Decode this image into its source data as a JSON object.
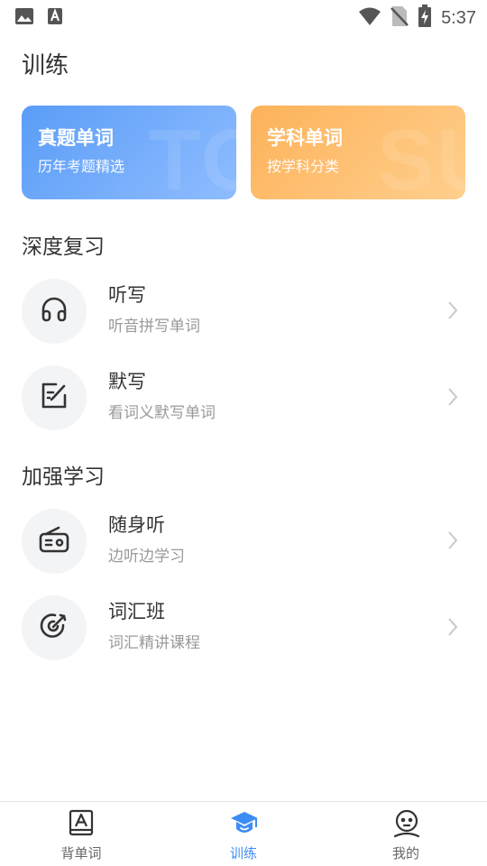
{
  "status_bar": {
    "time": "5:37"
  },
  "header": {
    "title": "训练"
  },
  "cards": [
    {
      "title": "真题单词",
      "subtitle": "历年考题精选",
      "watermark": "TO",
      "color": "#5a9df7"
    },
    {
      "title": "学科单词",
      "subtitle": "按学科分类",
      "watermark": "SU",
      "color": "#fdb25a"
    }
  ],
  "sections": {
    "deep_review": {
      "title": "深度复习",
      "items": [
        {
          "title": "听写",
          "subtitle": "听音拼写单词",
          "icon": "headphones-icon"
        },
        {
          "title": "默写",
          "subtitle": "看词义默写单词",
          "icon": "edit-icon"
        }
      ]
    },
    "enhanced_study": {
      "title": "加强学习",
      "items": [
        {
          "title": "随身听",
          "subtitle": "边听边学习",
          "icon": "radio-icon"
        },
        {
          "title": "词汇班",
          "subtitle": "词汇精讲课程",
          "icon": "target-icon"
        }
      ]
    }
  },
  "bottom_nav": {
    "items": [
      {
        "label": "背单词",
        "icon": "book-icon"
      },
      {
        "label": "训练",
        "icon": "graduation-cap-icon",
        "active": true
      },
      {
        "label": "我的",
        "icon": "profile-icon"
      }
    ],
    "active_color": "#3d8cf5"
  }
}
